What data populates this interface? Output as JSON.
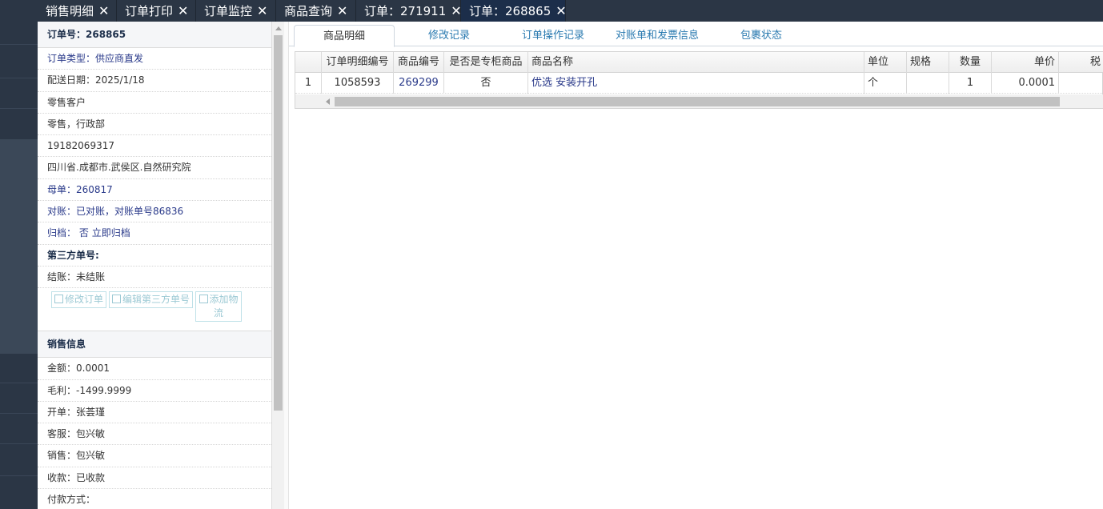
{
  "top_tabs": [
    {
      "label": "销售明细",
      "close": "✕"
    },
    {
      "label": "订单打印",
      "close": "✕"
    },
    {
      "label": "订单监控",
      "close": "✕"
    },
    {
      "label": "商品查询",
      "close": "✕"
    },
    {
      "label": "订单：271911",
      "close": "✕"
    },
    {
      "label": "订单：268865",
      "close": "✕"
    }
  ],
  "order_panel": {
    "order_no": "订单号：268865",
    "order_type_label": "订单类型：",
    "order_type_value": "供应商直发",
    "delivery_date": "配送日期：2025/1/18",
    "customer": "零售客户",
    "department": "零售，行政部",
    "phone": "19182069317",
    "address": "四川省.成都市.武侯区.自然研究院",
    "parent_order": "母单：260817",
    "reconcile": "对账：已对账，对账单号86836",
    "archive_label": "归档：",
    "archive_value": "否",
    "archive_link": "立即归档",
    "third_party": "第三方单号:",
    "settlement": "结账：未结账",
    "buttons": {
      "edit_order": "修改订单",
      "edit_third_party": "编辑第三方单号",
      "add_logistics": "添加物流"
    }
  },
  "sales_panel": {
    "title": "销售信息",
    "amount": "金额：0.0001",
    "gross_profit": "毛利：-1499.9999",
    "issuer": "开单：张荟瑾",
    "service": "客服：包兴敏",
    "sales": "销售：包兴敏",
    "collection": "收款：已收款",
    "payment_method": "付款方式："
  },
  "sub_tabs": [
    "商品明细",
    "修改记录",
    "订单操作记录",
    "对账单和发票信息",
    "包裹状态"
  ],
  "table": {
    "columns": [
      "",
      "订单明细编号",
      "商品编号",
      "是否是专柜商品",
      "商品名称",
      "单位",
      "规格",
      "数量",
      "单价",
      "税"
    ],
    "rows": [
      [
        "1",
        "1058593",
        "269299",
        "否",
        "优选 安装开孔",
        "个",
        "",
        "1",
        "0.0001",
        ""
      ]
    ]
  }
}
